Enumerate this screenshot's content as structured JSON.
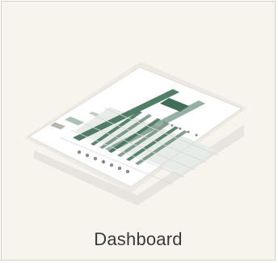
{
  "card": {
    "label": "Dashboard",
    "thumbnail_icon": "dashboard-preview-icon"
  },
  "colors": {
    "card_background": "#f7f4ee",
    "card_border": "#d8d2c6",
    "label_text": "#3a3a3a",
    "tablet_screen": "#ffffff",
    "accent_green": "#3f6f57",
    "muted_grey": "#c9c9c4"
  }
}
